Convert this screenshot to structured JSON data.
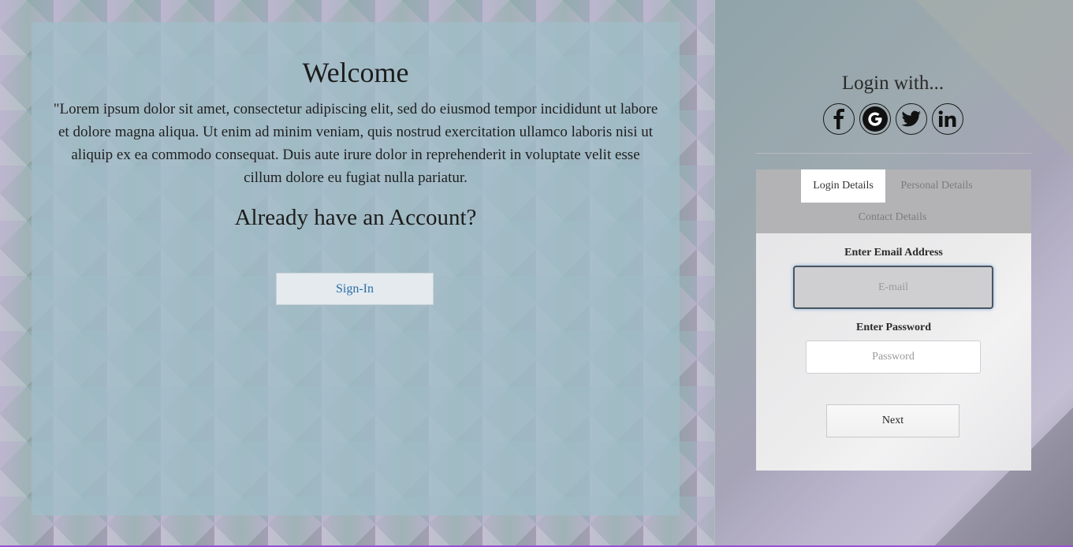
{
  "left": {
    "title": "Welcome",
    "body": "\"Lorem ipsum dolor sit amet, consectetur adipiscing elit, sed do eiusmod tempor incididunt ut labore et dolore magna aliqua. Ut enim ad minim veniam, quis nostrud exercitation ullamco laboris nisi ut aliquip ex ea commodo consequat. Duis aute irure dolor in reprehenderit in voluptate velit esse cillum dolore eu fugiat nulla pariatur.",
    "account_question": "Already have an Account?",
    "signin_label": "Sign-In"
  },
  "right": {
    "login_with": "Login with...",
    "social": [
      {
        "name": "facebook-icon",
        "glyph": "f"
      },
      {
        "name": "google-icon",
        "glyph": "G"
      },
      {
        "name": "twitter-icon",
        "glyph": "t"
      },
      {
        "name": "linkedin-icon",
        "glyph": "in"
      }
    ],
    "tabs": {
      "login": "Login Details",
      "personal": "Personal Details",
      "contact": "Contact Details"
    },
    "form": {
      "email_label": "Enter Email Address",
      "email_placeholder": "E-mail",
      "email_value": "",
      "password_label": "Enter Password",
      "password_placeholder": "Password",
      "password_value": "",
      "next_label": "Next"
    }
  },
  "colors": {
    "signin_text": "#2b6ea8",
    "bottom_accent": "#9a4fd6"
  }
}
